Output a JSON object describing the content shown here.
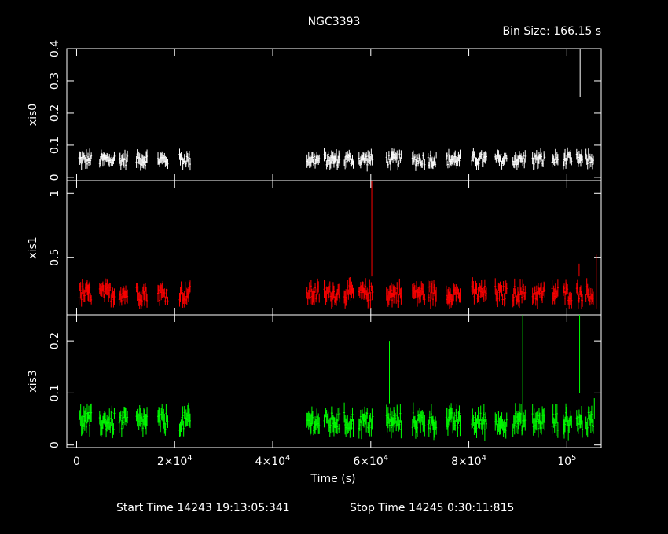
{
  "chart_data": {
    "type": "line",
    "title": "NGC3393",
    "bin_size_text": "Bin Size: 166.15 s",
    "xlabel": "Time (s)",
    "xlim": [
      -2000,
      107000
    ],
    "x_ticks": [
      {
        "value": 0,
        "label": "0",
        "exp": ""
      },
      {
        "value": 20000,
        "label": "2×10",
        "exp": "4"
      },
      {
        "value": 40000,
        "label": "4×10",
        "exp": "4"
      },
      {
        "value": 60000,
        "label": "6×10",
        "exp": "4"
      },
      {
        "value": 80000,
        "label": "8×10",
        "exp": "4"
      },
      {
        "value": 100000,
        "label": "10",
        "exp": "5"
      }
    ],
    "start_time_text": "Start Time 14243 19:13:05:341",
    "stop_time_text": "Stop Time 14245  0:30:11:815",
    "series": [
      {
        "name": "xis0",
        "color": "#ffffff",
        "ylim": [
          -0.01,
          0.4
        ],
        "yticks": [
          0,
          0.1,
          0.2,
          0.3,
          0.4
        ],
        "yticklabels": [
          "0",
          "0.1",
          "0.2",
          "0.3",
          "0.4"
        ],
        "base": 0.05,
        "noise": 0.035,
        "spikes": [
          [
            102700,
            0.25,
            0.4
          ]
        ]
      },
      {
        "name": "xis1",
        "color": "#ff0000",
        "ylim": [
          0.05,
          1.1
        ],
        "yticks": [
          0.5,
          1
        ],
        "yticklabels": [
          "0.5",
          "1"
        ],
        "base": 0.2,
        "noise": 0.12,
        "spikes": [
          [
            60200,
            0.35,
            1.1
          ],
          [
            102500,
            0.35,
            0.45
          ],
          [
            106000,
            0.1,
            0.52
          ]
        ]
      },
      {
        "name": "xis3",
        "color": "#00ff00",
        "ylim": [
          -0.005,
          0.25
        ],
        "yticks": [
          0,
          0.1,
          0.2
        ],
        "yticklabels": [
          "0",
          "0.1",
          "0.2"
        ],
        "base": 0.04,
        "noise": 0.035,
        "spikes": [
          [
            63800,
            0.08,
            0.2
          ],
          [
            91000,
            0.02,
            0.25
          ],
          [
            102600,
            0.1,
            0.25
          ],
          [
            105600,
            0.05,
            0.09
          ]
        ]
      }
    ],
    "segments": [
      [
        500,
        3000
      ],
      [
        4700,
        7800
      ],
      [
        8700,
        10500
      ],
      [
        12200,
        14400
      ],
      [
        16600,
        18600
      ],
      [
        21000,
        23200
      ],
      [
        47000,
        49500
      ],
      [
        50500,
        53800
      ],
      [
        54600,
        56500
      ],
      [
        57600,
        60500
      ],
      [
        63200,
        66300
      ],
      [
        68500,
        71000
      ],
      [
        71700,
        73500
      ],
      [
        75400,
        78300
      ],
      [
        80600,
        83600
      ],
      [
        85400,
        87800
      ],
      [
        89000,
        91500
      ],
      [
        93000,
        95600
      ],
      [
        97000,
        98200
      ],
      [
        99300,
        101000
      ],
      [
        102000,
        103300
      ],
      [
        103900,
        105500
      ]
    ]
  }
}
